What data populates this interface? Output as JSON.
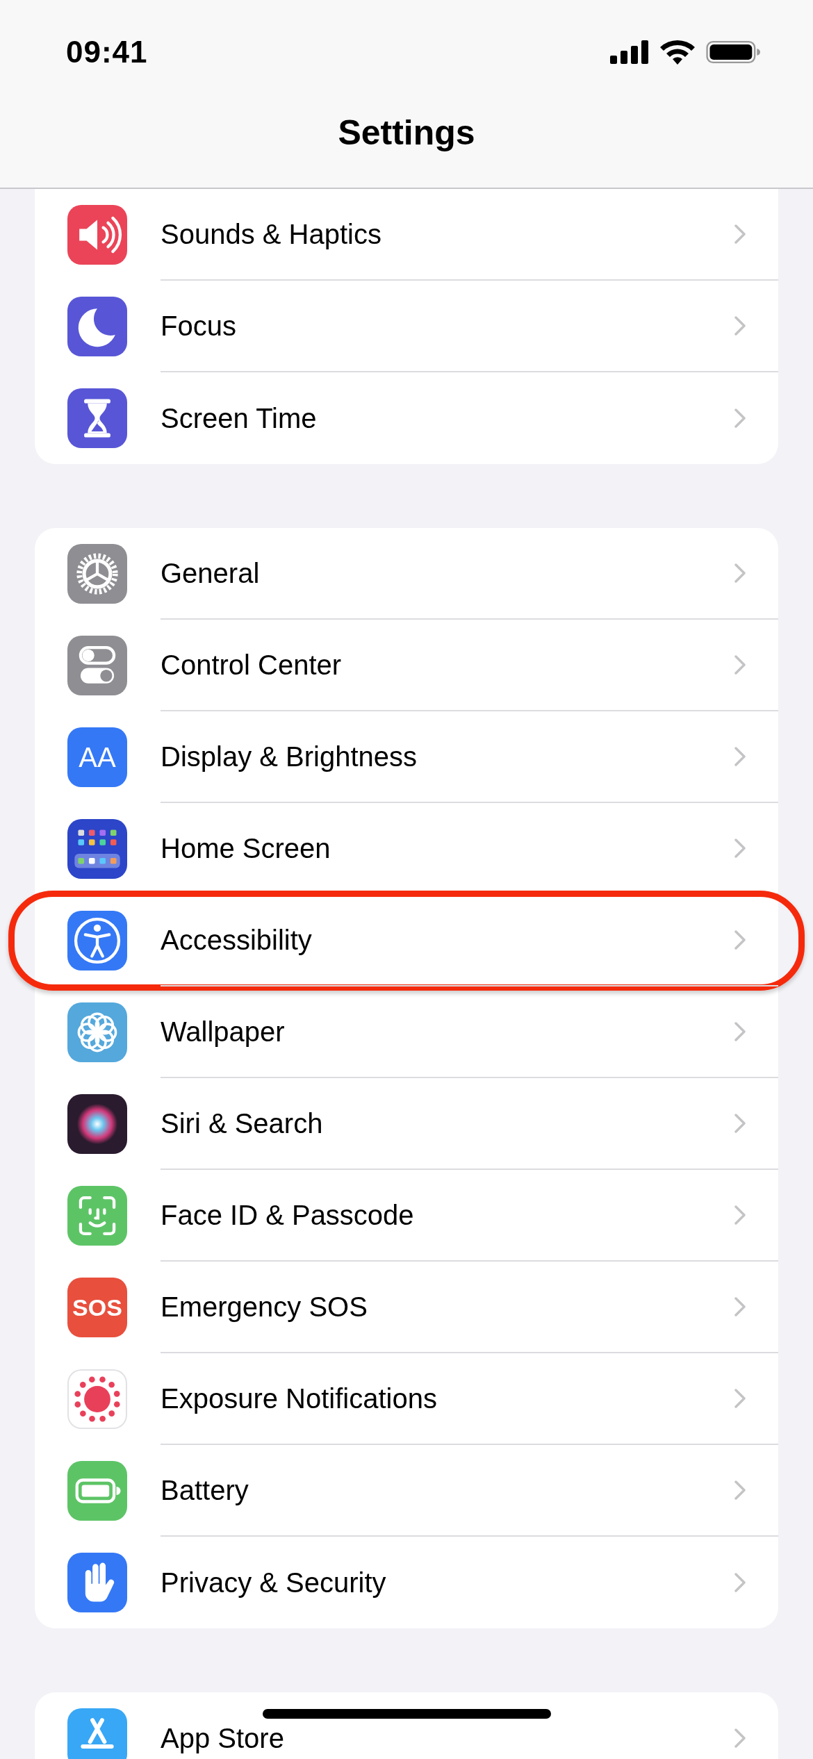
{
  "status_bar": {
    "time": "09:41"
  },
  "title": "Settings",
  "groups": [
    {
      "items": [
        {
          "label": "Sounds & Haptics",
          "color": "#eb4458",
          "highlighted": false
        },
        {
          "label": "Focus",
          "color": "#5856d6",
          "highlighted": false
        },
        {
          "label": "Screen Time",
          "color": "#5856d6",
          "highlighted": false
        }
      ]
    },
    {
      "items": [
        {
          "label": "General",
          "color": "#8e8e93",
          "highlighted": false
        },
        {
          "label": "Control Center",
          "color": "#8e8e93",
          "highlighted": false
        },
        {
          "label": "Display & Brightness",
          "color": "#3478f6",
          "icon_text": "AA",
          "highlighted": false
        },
        {
          "label": "Home Screen",
          "color": "#2c45c9",
          "highlighted": false
        },
        {
          "label": "Accessibility",
          "color": "#3478f6",
          "highlighted": true
        },
        {
          "label": "Wallpaper",
          "color": "#54a8dc",
          "highlighted": false
        },
        {
          "label": "Siri & Search",
          "color": "#2a1b2e",
          "highlighted": false
        },
        {
          "label": "Face ID & Passcode",
          "color": "#5dc466",
          "highlighted": false
        },
        {
          "label": "Emergency SOS",
          "color": "#e84f3d",
          "icon_text": "SOS",
          "highlighted": false
        },
        {
          "label": "Exposure Notifications",
          "color": "#ffffff",
          "highlighted": false
        },
        {
          "label": "Battery",
          "color": "#5dc466",
          "highlighted": false
        },
        {
          "label": "Privacy & Security",
          "color": "#3478f6",
          "highlighted": false
        }
      ]
    },
    {
      "items": [
        {
          "label": "App Store",
          "color": "#38a7f5",
          "highlighted": false
        }
      ]
    }
  ]
}
